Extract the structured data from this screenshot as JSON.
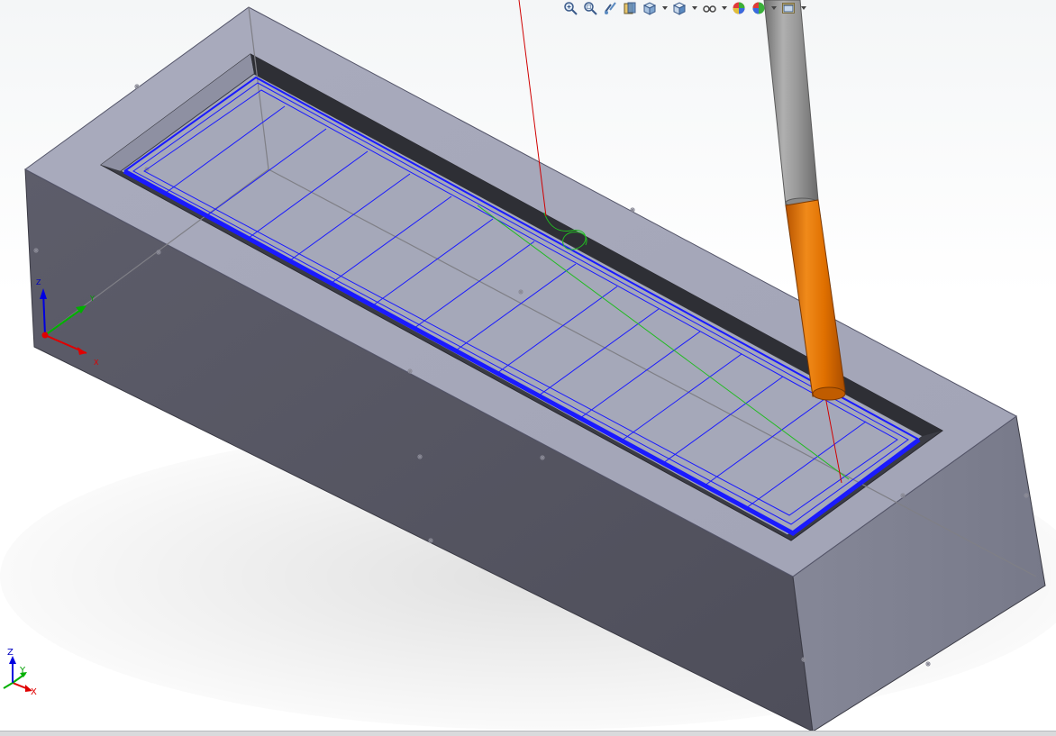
{
  "app": {
    "window_title": ""
  },
  "heads_up_toolbar": {
    "items": [
      {
        "icon": "zoom-to-fit-icon",
        "has_dropdown": false
      },
      {
        "icon": "zoom-to-area-icon",
        "has_dropdown": false
      },
      {
        "icon": "previous-view-icon",
        "has_dropdown": false
      },
      {
        "icon": "section-view-icon",
        "has_dropdown": false
      },
      {
        "icon": "view-orientation-icon",
        "has_dropdown": true
      },
      {
        "icon": "display-style-icon",
        "has_dropdown": true
      },
      {
        "icon": "hide-show-items-icon",
        "has_dropdown": true
      },
      {
        "icon": "edit-appearance-icon",
        "has_dropdown": false
      },
      {
        "icon": "apply-scene-icon",
        "has_dropdown": true
      },
      {
        "icon": "view-settings-icon",
        "has_dropdown": true
      }
    ]
  },
  "triad_origin": {
    "x_label": "X",
    "y_label": "Y",
    "z_label": "Z"
  },
  "triad_corner": {
    "x_label": "X",
    "y_label": "Y",
    "z_label": "Z"
  },
  "colors": {
    "background_top": "#f4f6f7",
    "block_top_face": "#a6a8ba",
    "block_front_face": "#545461",
    "block_side_face": "#7d7f8f",
    "pocket_wall": "#3a3b42",
    "pocket_floor": "#a4a7b8",
    "toolpath_blue": "#0000ff",
    "tool_shank": "#8c8c8c",
    "tool_cutter": "#e07000",
    "axis_x": "#d00000",
    "axis_y": "#00b000",
    "axis_z": "#0000d0",
    "hidden_line": "#7a7a7a"
  }
}
